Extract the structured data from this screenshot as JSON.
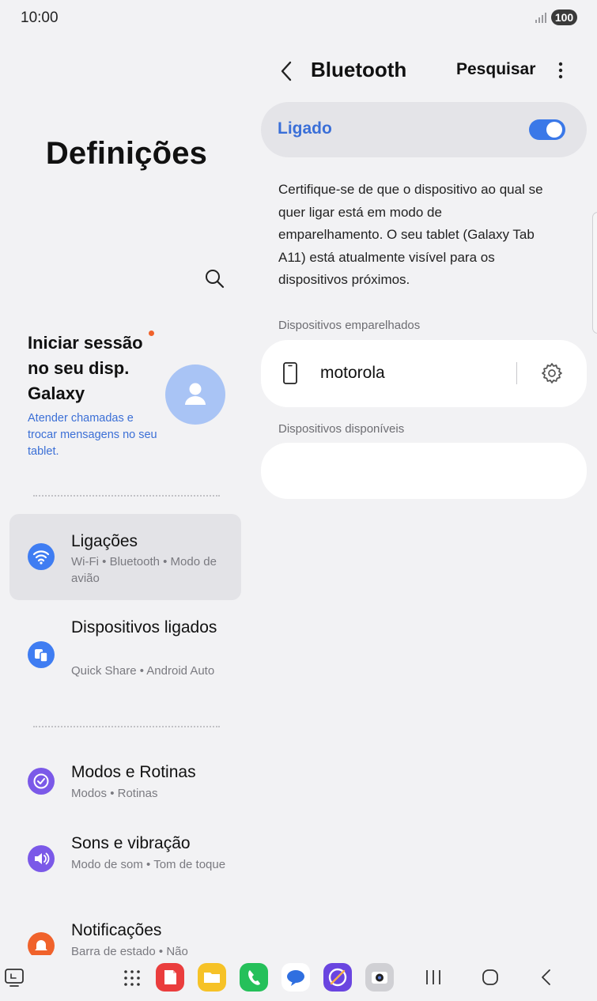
{
  "status_bar": {
    "time": "10:00",
    "battery": "100"
  },
  "settings_pane": {
    "title": "Definições",
    "account": {
      "title": "Iniciar sessão no seu disp. Galaxy",
      "subtitle": "Atender chamadas e trocar mensagens no seu tablet."
    },
    "menu": [
      {
        "title": "Ligações",
        "subtitle": "Wi-Fi • Bluetooth • Modo de avião",
        "icon": "wifi-icon",
        "color": "#3f7df2",
        "active": true
      },
      {
        "title": "Dispositivos ligados",
        "subtitle": "Quick Share • Android Auto",
        "icon": "connected-devices-icon",
        "color": "#3f7df2",
        "active": false
      },
      {
        "title": "Modos e Rotinas",
        "subtitle": "Modos • Rotinas",
        "icon": "modes-routines-icon",
        "color": "#7b59e8",
        "active": false
      },
      {
        "title": "Sons e vibração",
        "subtitle": "Modo de som • Tom de toque",
        "icon": "volume-icon",
        "color": "#7b59e8",
        "active": false
      },
      {
        "title": "Notificações",
        "subtitle": "Barra de estado • Não",
        "icon": "bell-icon",
        "color": "#f0622b",
        "active": false
      }
    ]
  },
  "bluetooth_pane": {
    "title": "Bluetooth",
    "search_label": "Pesquisar",
    "toggle_label": "Ligado",
    "toggle_on": true,
    "description": "Certifique-se de que o dispositivo ao qual se quer ligar está em modo de emparelhamento. O seu tablet (Galaxy Tab A11) está atualmente visível para os dispositivos próximos.",
    "paired_label": "Dispositivos emparelhados",
    "paired_devices": [
      {
        "name": "motorola",
        "icon": "smartphone-icon"
      }
    ],
    "available_label": "Dispositivos disponíveis",
    "accent_color": "#3a6fd8"
  },
  "dock": {
    "apps": [
      {
        "name": "notes-app-icon",
        "color": "#ea3d3d"
      },
      {
        "name": "my-files-app-icon",
        "color": "#f6c227"
      },
      {
        "name": "phone-app-icon",
        "color": "#25c05a"
      },
      {
        "name": "messages-app-icon",
        "color": "#ffffff"
      },
      {
        "name": "internet-app-icon",
        "color": "#6a45e0"
      },
      {
        "name": "camera-app-icon",
        "color": "#d0d0d4"
      }
    ]
  }
}
